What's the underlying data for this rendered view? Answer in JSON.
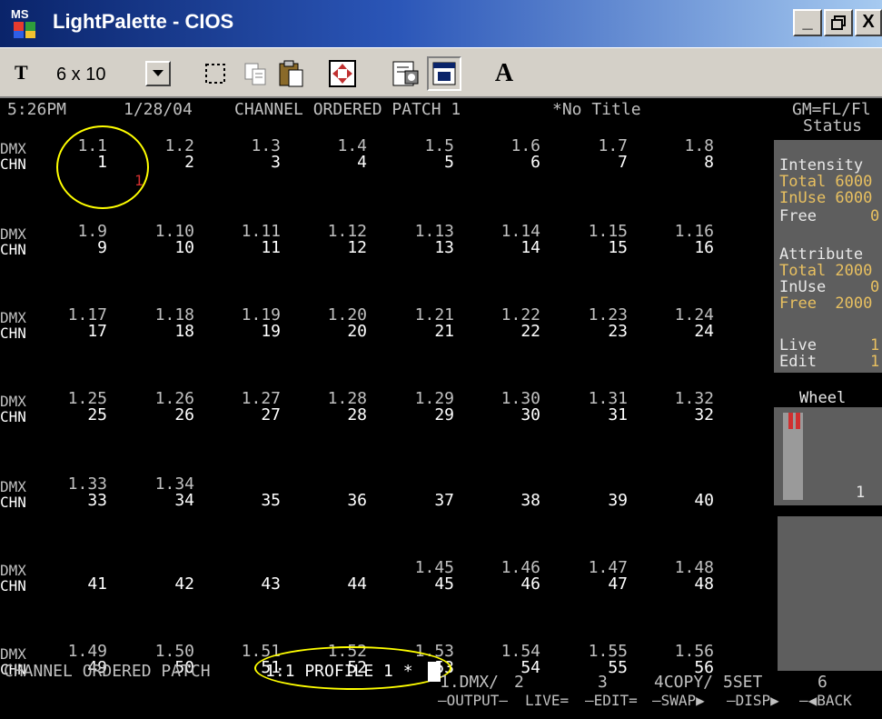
{
  "window": {
    "title": "LightPalette - CIOS",
    "app_icon_text": "MS",
    "controls": [
      "_",
      "Ő",
      "X"
    ]
  },
  "toolbar": {
    "font_icon": "T",
    "font_size_value": "6 x 10",
    "buttons": [
      "select-region-icon",
      "copy-icon",
      "paste-icon",
      "move-icon",
      "properties-icon",
      "window-icon",
      "font-a-icon"
    ],
    "font_button_label": "A"
  },
  "header": {
    "time": "5:26PM",
    "date": "1/28/04",
    "screen_name": "CHANNEL ORDERED PATCH 1",
    "show_title": "*No Title",
    "gm": "GM=FL/Fl",
    "status": "Status"
  },
  "patch_rows": [
    {
      "dmx": [
        "1.1",
        "1.2",
        "1.3",
        "1.4",
        "1.5",
        "1.6",
        "1.7",
        "1.8"
      ],
      "chn": [
        "1",
        "2",
        "3",
        "4",
        "5",
        "6",
        "7",
        "8"
      ]
    },
    {
      "dmx": [
        "1.9",
        "1.10",
        "1.11",
        "1.12",
        "1.13",
        "1.14",
        "1.15",
        "1.16"
      ],
      "chn": [
        "9",
        "10",
        "11",
        "12",
        "13",
        "14",
        "15",
        "16"
      ]
    },
    {
      "dmx": [
        "1.17",
        "1.18",
        "1.19",
        "1.20",
        "1.21",
        "1.22",
        "1.23",
        "1.24"
      ],
      "chn": [
        "17",
        "18",
        "19",
        "20",
        "21",
        "22",
        "23",
        "24"
      ]
    },
    {
      "dmx": [
        "1.25",
        "1.26",
        "1.27",
        "1.28",
        "1.29",
        "1.30",
        "1.31",
        "1.32"
      ],
      "chn": [
        "25",
        "26",
        "27",
        "28",
        "29",
        "30",
        "31",
        "32"
      ]
    },
    {
      "dmx": [
        "1.33",
        "1.34",
        "",
        "",
        "",
        "",
        "",
        ""
      ],
      "chn": [
        "33",
        "34",
        "35",
        "36",
        "37",
        "38",
        "39",
        "40"
      ]
    },
    {
      "dmx": [
        "",
        "",
        "",
        "",
        "1.45",
        "1.46",
        "1.47",
        "1.48"
      ],
      "chn": [
        "41",
        "42",
        "43",
        "44",
        "45",
        "46",
        "47",
        "48"
      ]
    },
    {
      "dmx": [
        "1.49",
        "1.50",
        "1.51",
        "1.52",
        "1.53",
        "1.54",
        "1.55",
        "1.56"
      ],
      "chn": [
        "49",
        "50",
        "51",
        "52",
        "53",
        "54",
        "55",
        "56"
      ]
    }
  ],
  "row_labels": {
    "dmx": "DMX",
    "chn": "CHN"
  },
  "profile_marker": "1",
  "status_panel": {
    "intensity_label": "Intensity",
    "intensity_total": "Total 6000",
    "intensity_inuse": "InUse 6000",
    "intensity_free_label": "Free",
    "intensity_free_value": "0",
    "attribute_label": "Attribute",
    "attribute_total": "Total 2000",
    "attribute_inuse_label": "InUse",
    "attribute_inuse_value": "0",
    "attribute_free": "Free  2000",
    "live_label": "Live",
    "live_value": "1",
    "edit_label": "Edit",
    "edit_value": "1",
    "wheel_label": "Wheel",
    "wheel_value": "1"
  },
  "command_line": {
    "prefix": "CHANNEL ORDERED PATCH",
    "entry": "1:1 PROFILE 1 *"
  },
  "softkeys": {
    "top": [
      "1.DMX/",
      "2",
      "3",
      "4COPY/",
      "5SET",
      "6"
    ],
    "bottom": [
      "—OUTPUT—",
      "LIVE=",
      "—EDIT=",
      "—SWAP▶",
      "—DISP▶",
      "—◀BACK"
    ]
  },
  "colors": {
    "title_gradient_start": "#0a246a",
    "annotation": "#ffff00",
    "accent_total": "#d4a000",
    "marker_red": "#d03030"
  }
}
